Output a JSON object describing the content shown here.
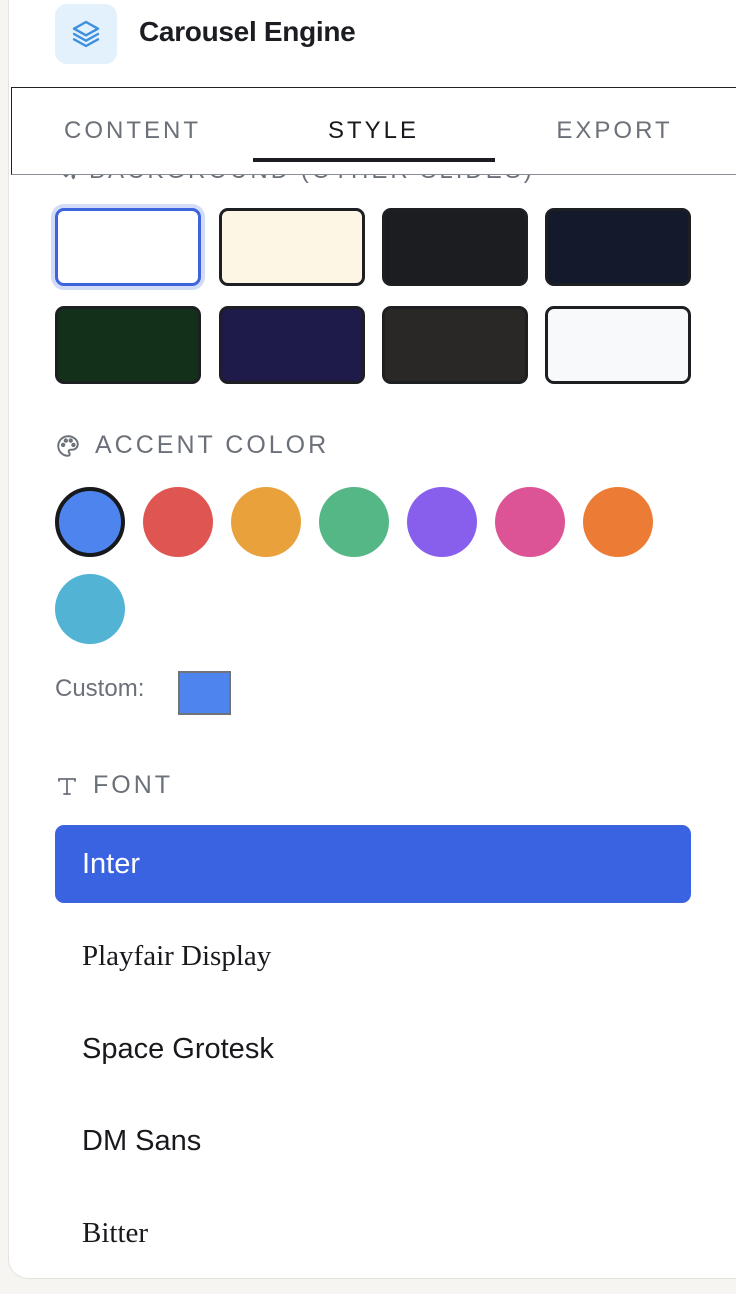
{
  "app": {
    "title": "Carousel Engine",
    "logo_icon": "layers-icon",
    "logo_color": "#3d8fe0"
  },
  "tabs": [
    {
      "label": "CONTENT",
      "active": false
    },
    {
      "label": "STYLE",
      "active": true
    },
    {
      "label": "EXPORT",
      "active": false
    }
  ],
  "background": {
    "label": "BACKGROUND (OTHER SLIDES)",
    "icon": "paint-bucket-icon",
    "swatches": [
      {
        "color": "#ffffff",
        "selected": true
      },
      {
        "color": "#fdf6e5",
        "selected": false
      },
      {
        "color": "#1c1d21",
        "selected": false
      },
      {
        "color": "#131a2c",
        "selected": false
      },
      {
        "color": "#13301b",
        "selected": false
      },
      {
        "color": "#1e1b4b",
        "selected": false
      },
      {
        "color": "#2a2827",
        "selected": false
      },
      {
        "color": "#f8f9fb",
        "selected": false
      }
    ]
  },
  "accent": {
    "label": "ACCENT COLOR",
    "icon": "palette-icon",
    "colors": [
      {
        "color": "#4e84ee",
        "selected": true
      },
      {
        "color": "#df5552",
        "selected": false
      },
      {
        "color": "#e9a23b",
        "selected": false
      },
      {
        "color": "#54b785",
        "selected": false
      },
      {
        "color": "#875fec",
        "selected": false
      },
      {
        "color": "#dc5495",
        "selected": false
      },
      {
        "color": "#ec7b35",
        "selected": false
      },
      {
        "color": "#52b3d4",
        "selected": false
      }
    ],
    "custom_label": "Custom:",
    "custom_color": "#4e84ee"
  },
  "font": {
    "label": "FONT",
    "icon": "type-icon",
    "options": [
      {
        "label": "Inter",
        "selected": true
      },
      {
        "label": "Playfair Display",
        "selected": false
      },
      {
        "label": "Space Grotesk",
        "selected": false
      },
      {
        "label": "DM Sans",
        "selected": false
      },
      {
        "label": "Bitter",
        "selected": false
      }
    ]
  }
}
